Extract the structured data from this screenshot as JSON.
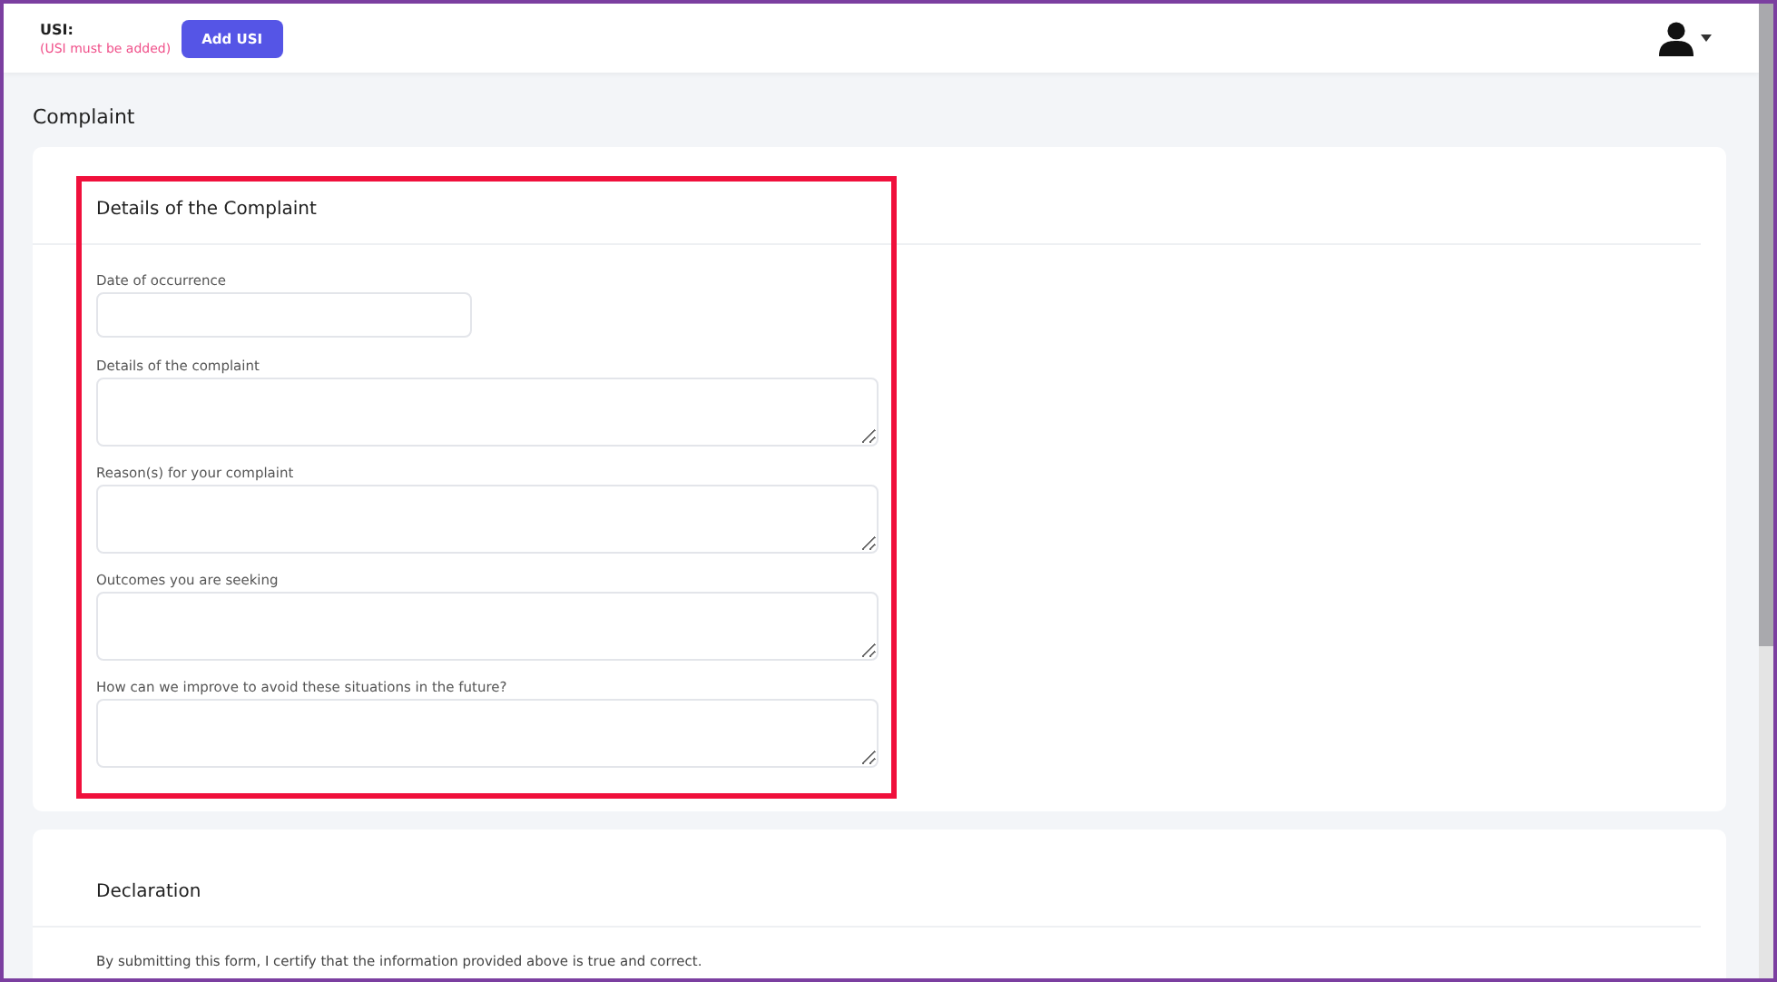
{
  "header": {
    "usi_label": "USI:",
    "usi_warning": "(USI must be added)",
    "add_button": "Add USI"
  },
  "page_title": "Complaint",
  "details_card": {
    "title": "Details of the Complaint",
    "highlighted": true,
    "fields": [
      {
        "label": "Date of occurrence",
        "kind": "input"
      },
      {
        "label": "Details of the complaint",
        "kind": "textarea"
      },
      {
        "label": "Reason(s) for your complaint",
        "kind": "textarea"
      },
      {
        "label": "Outcomes you are seeking",
        "kind": "textarea"
      },
      {
        "label": "How can we improve to avoid these situations in the future?",
        "kind": "textarea"
      }
    ]
  },
  "declaration_card": {
    "title": "Declaration",
    "text": "By submitting this form, I certify that the information provided above is true and correct."
  }
}
